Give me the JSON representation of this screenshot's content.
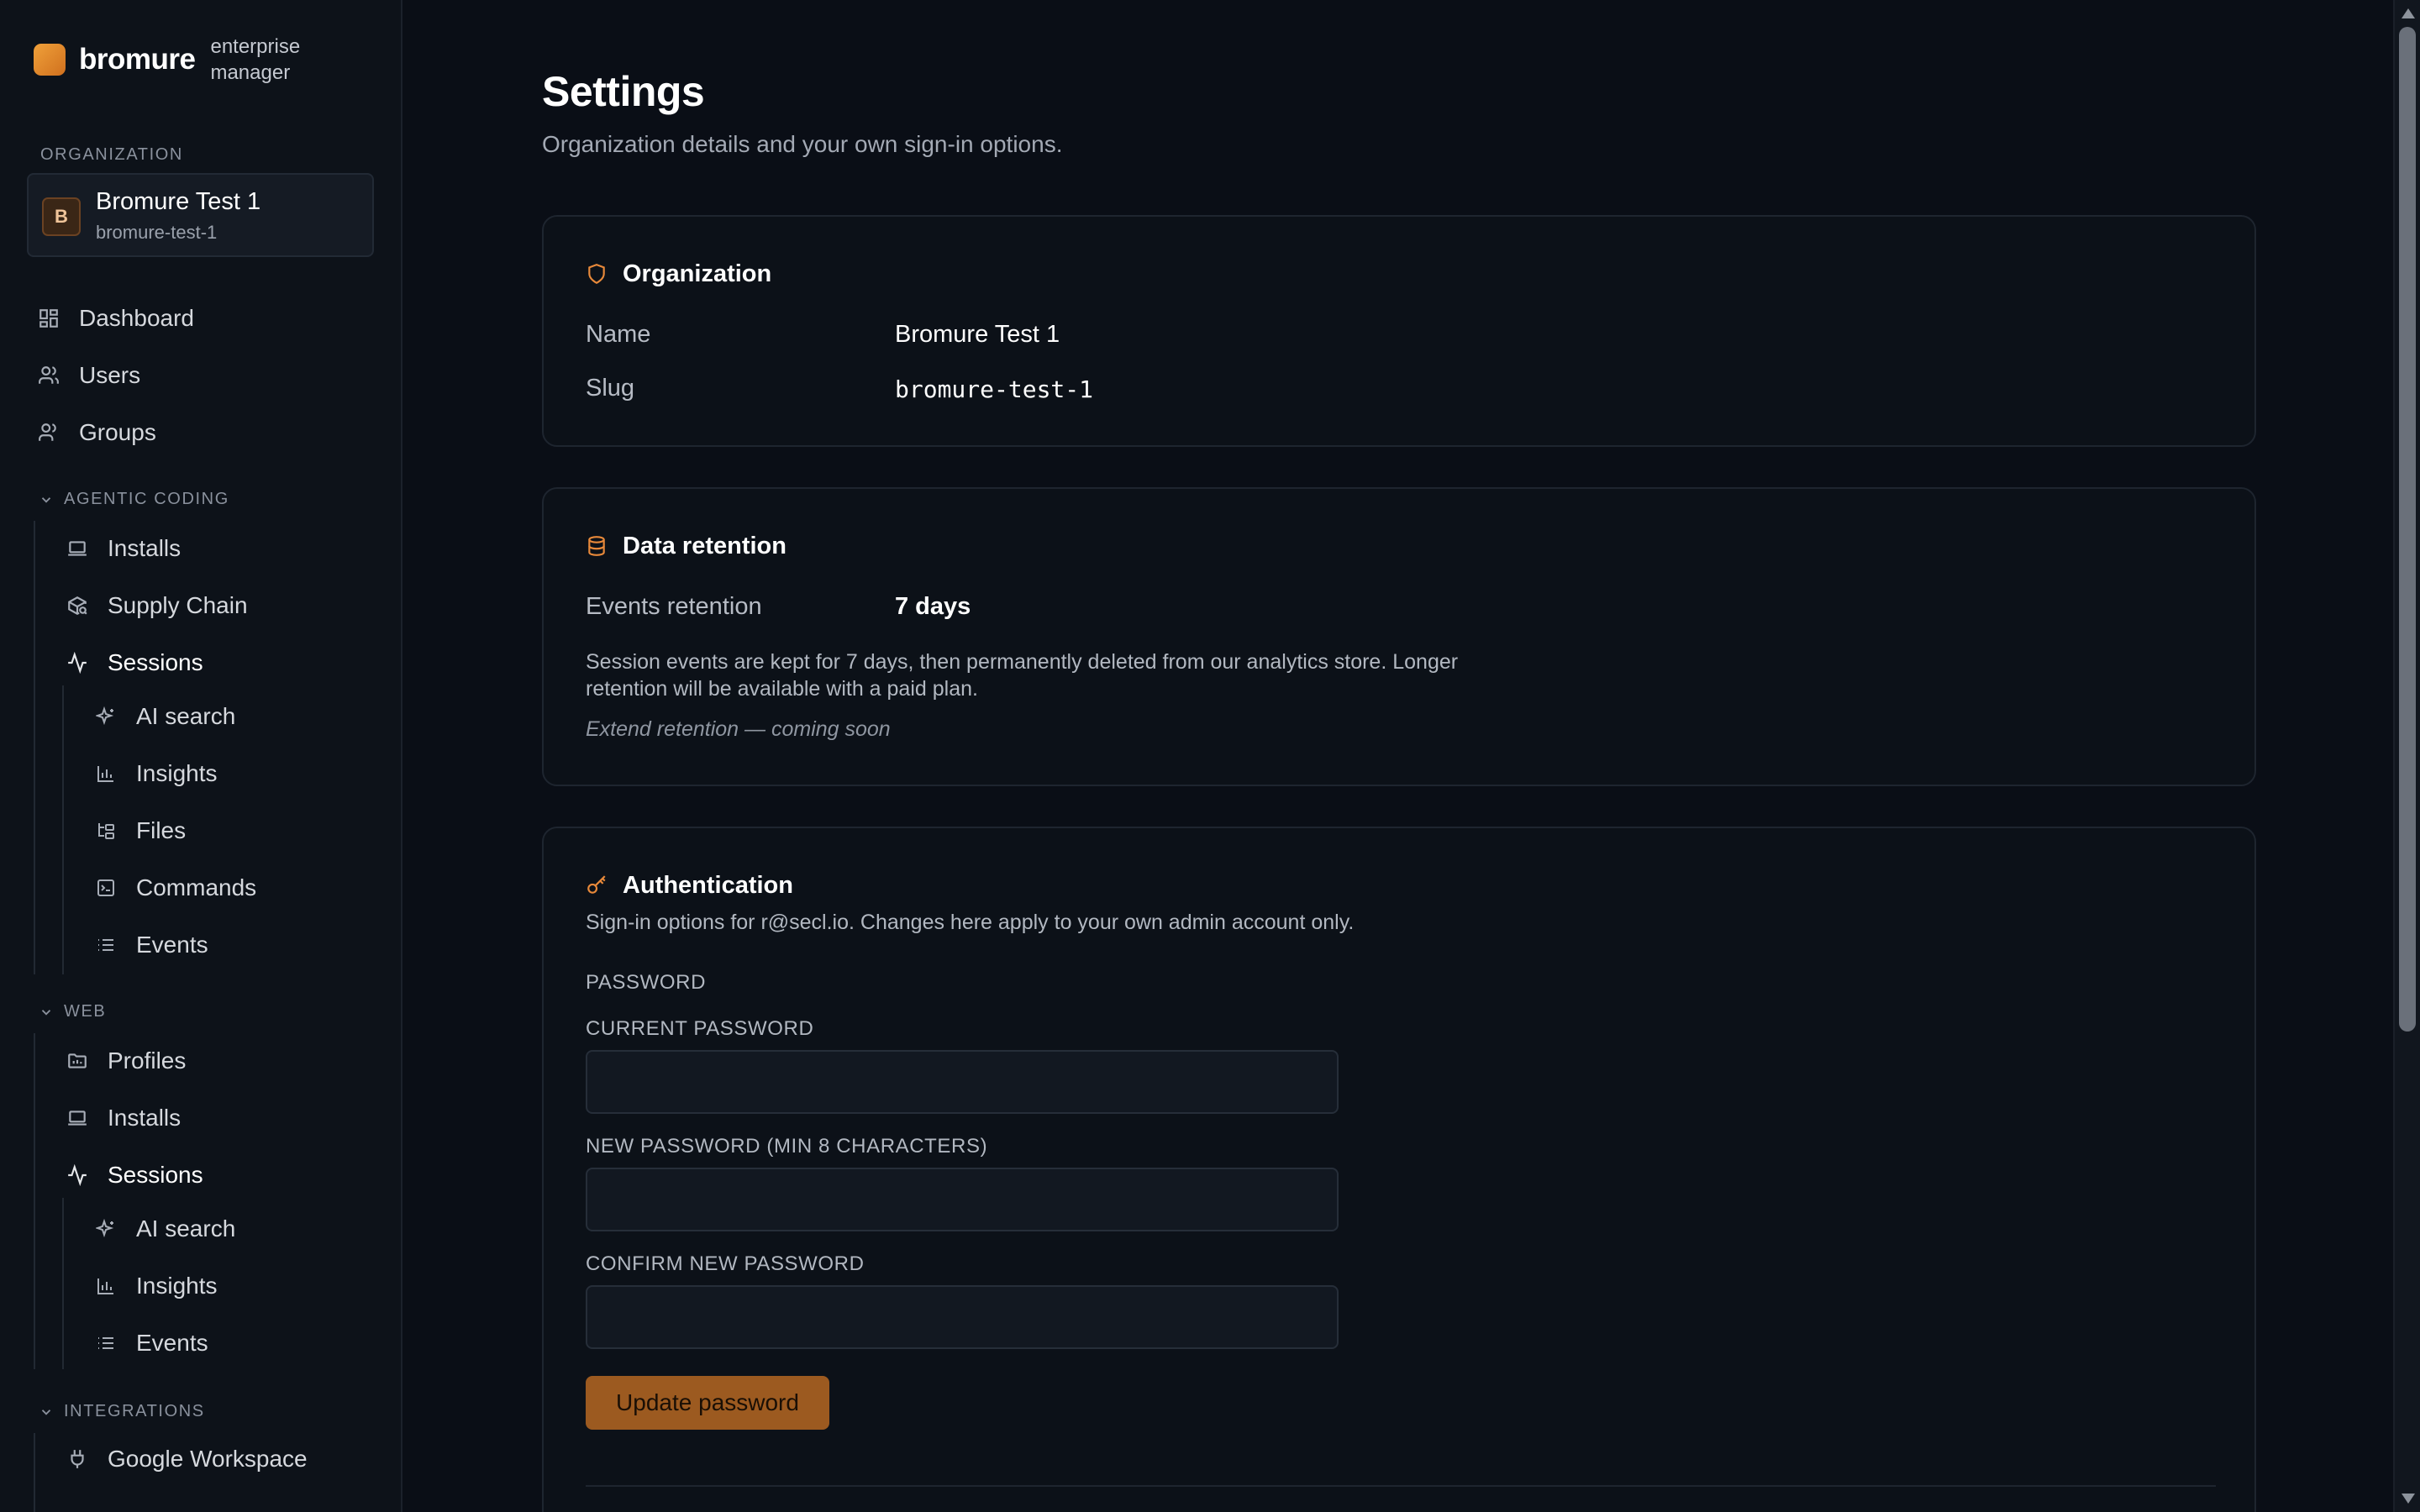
{
  "brand": {
    "name": "bromure",
    "subtitle": "enterprise manager"
  },
  "sidebar": {
    "org_section_label": "ORGANIZATION",
    "org": {
      "avatar": "B",
      "name": "Bromure Test 1",
      "slug": "bromure-test-1"
    },
    "top_items": [
      {
        "label": "Dashboard",
        "icon": "dashboard-icon"
      },
      {
        "label": "Users",
        "icon": "users-icon"
      },
      {
        "label": "Groups",
        "icon": "groups-icon"
      }
    ],
    "agentic": {
      "label": "AGENTIC CODING",
      "items": [
        {
          "label": "Installs",
          "icon": "laptop-icon"
        },
        {
          "label": "Supply Chain",
          "icon": "package-search-icon"
        },
        {
          "label": "Sessions",
          "icon": "activity-icon"
        }
      ],
      "sub_items": [
        {
          "label": "AI search",
          "icon": "sparkles-icon"
        },
        {
          "label": "Insights",
          "icon": "bar-chart-icon"
        },
        {
          "label": "Files",
          "icon": "folder-tree-icon"
        },
        {
          "label": "Commands",
          "icon": "terminal-icon"
        },
        {
          "label": "Events",
          "icon": "list-icon"
        }
      ]
    },
    "web": {
      "label": "WEB",
      "items": [
        {
          "label": "Profiles",
          "icon": "folder-icon"
        },
        {
          "label": "Installs",
          "icon": "laptop-icon"
        },
        {
          "label": "Sessions",
          "icon": "activity-icon"
        }
      ],
      "sub_items": [
        {
          "label": "AI search",
          "icon": "sparkles-icon"
        },
        {
          "label": "Insights",
          "icon": "bar-chart-icon"
        },
        {
          "label": "Events",
          "icon": "list-icon"
        }
      ]
    },
    "integrations": {
      "label": "INTEGRATIONS",
      "items": [
        {
          "label": "Google Workspace",
          "icon": "plug-icon"
        }
      ]
    }
  },
  "page": {
    "title": "Settings",
    "subtitle": "Organization details and your own sign-in options."
  },
  "organization_card": {
    "title": "Organization",
    "name_label": "Name",
    "name_value": "Bromure Test 1",
    "slug_label": "Slug",
    "slug_value": "bromure-test-1"
  },
  "retention_card": {
    "title": "Data retention",
    "events_label": "Events retention",
    "events_value": "7 days",
    "note": "Session events are kept for 7 days, then permanently deleted from our analytics store. Longer retention will be available with a paid plan.",
    "extend": "Extend retention — coming soon"
  },
  "auth_card": {
    "title": "Authentication",
    "subtitle": "Sign-in options for r@secl.io. Changes here apply to your own admin account only.",
    "password_section": "PASSWORD",
    "current_label": "CURRENT PASSWORD",
    "new_label": "NEW PASSWORD (MIN 8 CHARACTERS)",
    "confirm_label": "CONFIRM NEW PASSWORD",
    "current_value": "",
    "new_value": "",
    "confirm_value": "",
    "update_button": "Update password"
  },
  "colors": {
    "accent": "#e8893a",
    "button": "#9c5a20",
    "background": "#0a0e16",
    "sidebar": "#0d1219"
  }
}
